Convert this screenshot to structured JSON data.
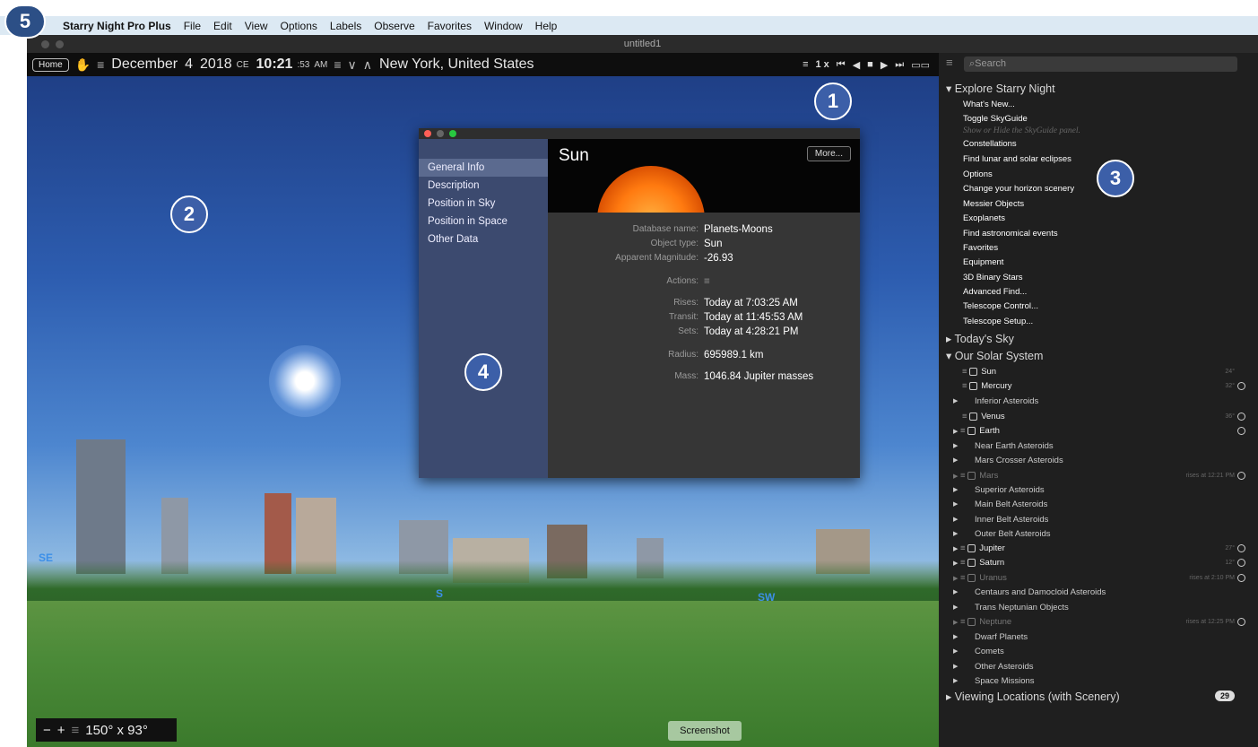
{
  "menubar": {
    "app": "Starry Night Pro Plus",
    "items": [
      "File",
      "Edit",
      "View",
      "Options",
      "Labels",
      "Observe",
      "Favorites",
      "Window",
      "Help"
    ]
  },
  "window": {
    "title": "untitled1"
  },
  "toolbar": {
    "home": "Home",
    "month": "December",
    "day": "4",
    "year": "2018",
    "era": "CE",
    "time": "10:21",
    "seconds": ":53",
    "ampm": "AM",
    "location": "New York, United States",
    "rate": "1 x"
  },
  "scene": {
    "compass": [
      "SE",
      "S",
      "SW"
    ],
    "fov": "150° x 93°",
    "screenshot_label": "Screenshot"
  },
  "info": {
    "tabs": [
      "General Info",
      "Description",
      "Position in Sky",
      "Position in Space",
      "Other Data"
    ],
    "name": "Sun",
    "more": "More...",
    "database_label": "Database name:",
    "database": "Planets-Moons",
    "type_label": "Object type:",
    "type": "Sun",
    "mag_label": "Apparent Magnitude:",
    "mag": "-26.93",
    "actions_label": "Actions:",
    "rises_label": "Rises:",
    "rises": "Today at 7:03:25 AM",
    "transit_label": "Transit:",
    "transit": "Today at 11:45:53 AM",
    "sets_label": "Sets:",
    "sets": "Today at 4:28:21 PM",
    "radius_label": "Radius:",
    "radius": "695989.1 km",
    "mass_label": "Mass:",
    "mass": "1046.84 Jupiter masses"
  },
  "sidebar": {
    "search_placeholder": "Search",
    "explore_title": "Explore Starry Night",
    "explore_items": [
      "What's New...",
      "Toggle SkyGuide",
      "Constellations",
      "Find lunar and solar eclipses",
      "Options",
      "Change your horizon scenery",
      "Messier Objects",
      "Exoplanets",
      "Find astronomical events",
      "Favorites",
      "Equipment",
      "3D Binary Stars",
      "Advanced Find...",
      "Telescope Control...",
      "Telescope Setup..."
    ],
    "skyguide_hint": "Show or Hide the SkyGuide panel.",
    "todays_sky": "Today's Sky",
    "solar_title": "Our Solar System",
    "solar": [
      {
        "label": "Sun",
        "meta": "24°"
      },
      {
        "label": "Mercury",
        "meta": "32°"
      },
      {
        "label": "Inferior Asteroids",
        "meta": ""
      },
      {
        "label": "Venus",
        "meta": "36°"
      },
      {
        "label": "Earth",
        "meta": ""
      },
      {
        "label": "Near Earth Asteroids",
        "meta": ""
      },
      {
        "label": "Mars Crosser Asteroids",
        "meta": ""
      },
      {
        "label": "Mars",
        "meta": "rises at 12:21 PM"
      },
      {
        "label": "Superior Asteroids",
        "meta": ""
      },
      {
        "label": "Main Belt Asteroids",
        "meta": ""
      },
      {
        "label": "Inner Belt Asteroids",
        "meta": ""
      },
      {
        "label": "Outer Belt Asteroids",
        "meta": ""
      },
      {
        "label": "Jupiter",
        "meta": "27°"
      },
      {
        "label": "Saturn",
        "meta": "12°"
      },
      {
        "label": "Uranus",
        "meta": "rises at 2:10 PM"
      },
      {
        "label": "Centaurs and Damocloid Asteroids",
        "meta": ""
      },
      {
        "label": "Trans Neptunian Objects",
        "meta": ""
      },
      {
        "label": "Neptune",
        "meta": "rises at 12:25 PM"
      },
      {
        "label": "Dwarf Planets",
        "meta": ""
      },
      {
        "label": "Comets",
        "meta": ""
      },
      {
        "label": "Other Asteroids",
        "meta": ""
      },
      {
        "label": "Space Missions",
        "meta": ""
      }
    ],
    "locations": "Viewing Locations (with Scenery)",
    "locations_count": "29"
  },
  "callouts": [
    "1",
    "2",
    "3",
    "4",
    "5"
  ]
}
